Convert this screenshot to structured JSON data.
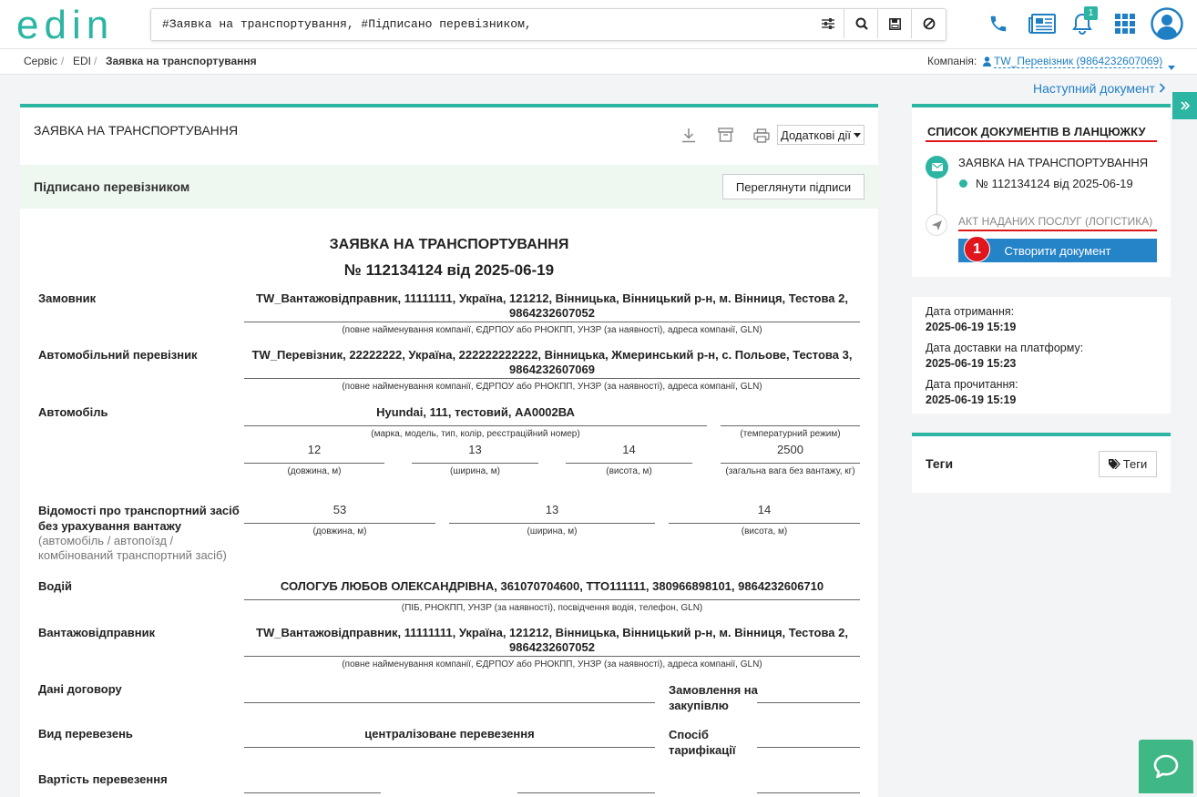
{
  "header": {
    "logo": "edin",
    "search_value": "#Заявка на транспортування, #Підписано перевізником,",
    "notification_count": "1"
  },
  "breadcrumb": {
    "items": [
      "Сервіс",
      "EDI",
      "Заявка на транспортування"
    ],
    "company_label": "Компанія:",
    "company_value": "TW_Перевізник (9864232607069)"
  },
  "next_document": "Наступний документ",
  "document": {
    "panel_title": "ЗАЯВКА НА ТРАНСПОРТУВАННЯ",
    "additional_actions": "Додаткові дії",
    "status": "Підписано перевізником",
    "view_signatures": "Переглянути підписи",
    "title": "ЗАЯВКА НА ТРАНСПОРТУВАННЯ",
    "subtitle": "№ 112134124 від 2025-06-19",
    "customer_label": "Замовник",
    "customer_value": "TW_Вантажовідправник, 11111111, Україна, 121212, Вінницька, Вінницький р-н, м. Вінниця, Тестова 2, 9864232607052",
    "company_hint": "(повне найменування компанії, ЄДРПОУ або РНОКПП, УНЗР (за наявності), адреса компанії, GLN)",
    "carrier_label": "Автомобільний перевізник",
    "carrier_value": "TW_Перевізник, 22222222, Україна, 222222222222, Вінницька, Жмеринський р-н, с. Польове, Тестова 3, 9864232607069",
    "car_label": "Автомобіль",
    "car_value": "Hyundai, 111, тестовий, АА0002ВА",
    "car_hint": "(марка, модель, тип, колір, реєстраційний номер)",
    "temp_hint": "(температурний режим)",
    "car_length": "12",
    "car_width": "13",
    "car_height": "14",
    "car_weight": "2500",
    "length_hint": "(довжина, м)",
    "width_hint": "(ширина, м)",
    "height_hint": "(висота, м)",
    "weight_hint": "(загальна вага без вантажу, кг)",
    "vehicle_label": "Відомості про транспортний засіб без урахування вантажу",
    "vehicle_sub": "(автомобіль / автопоїзд / комбінований транспортний засіб)",
    "veh_length": "53",
    "veh_width": "13",
    "veh_height": "14",
    "driver_label": "Водій",
    "driver_value": "СОЛОГУБ ЛЮБОВ ОЛЕКСАНДРІВНА, 361070704600, ТТО111111, 380966898101, 9864232606710",
    "driver_hint": "(ПІБ, РНОКПП, УНЗР (за наявності), посвідчення водія, телефон, GLN)",
    "shipper_label": "Вантажовідправник",
    "shipper_value": "TW_Вантажовідправник, 11111111, Україна, 121212, Вінницька, Вінницький р-н, м. Вінниця, Тестова 2, 9864232607052",
    "contract_label": "Дані договору",
    "procurement_label": "Замовлення на закупівлю",
    "transport_kind_label": "Вид перевезень",
    "transport_kind_value": "централізоване перевезення",
    "tariff_label": "Спосіб тарифікації",
    "cost_label": "Вартість перевезення"
  },
  "chain": {
    "title": "СПИСОК ДОКУМЕНТІВ В ЛАНЦЮЖКУ",
    "doc1_title": "ЗАЯВКА НА ТРАНСПОРТУВАННЯ",
    "doc1_number": "№ 112134124 від 2025-06-19",
    "doc2_title": "АКТ НАДАНИХ ПОСЛУГ (ЛОГІСТИКА)",
    "create_button": "Створити документ",
    "marker": "1"
  },
  "dates": {
    "received_label": "Дата отримання:",
    "received_value": "2025-06-19 15:19",
    "delivered_label": "Дата доставки на платформу:",
    "delivered_value": "2025-06-19 15:23",
    "read_label": "Дата прочитання:",
    "read_value": "2025-06-19 15:19"
  },
  "tags": {
    "title": "Теги",
    "button": "Теги"
  },
  "colors": {
    "accent": "#2bb5a2",
    "link": "#1f7fc4",
    "primary_button": "#2583c8",
    "marker": "#e0161c",
    "status_bg": "#eef8f1"
  }
}
